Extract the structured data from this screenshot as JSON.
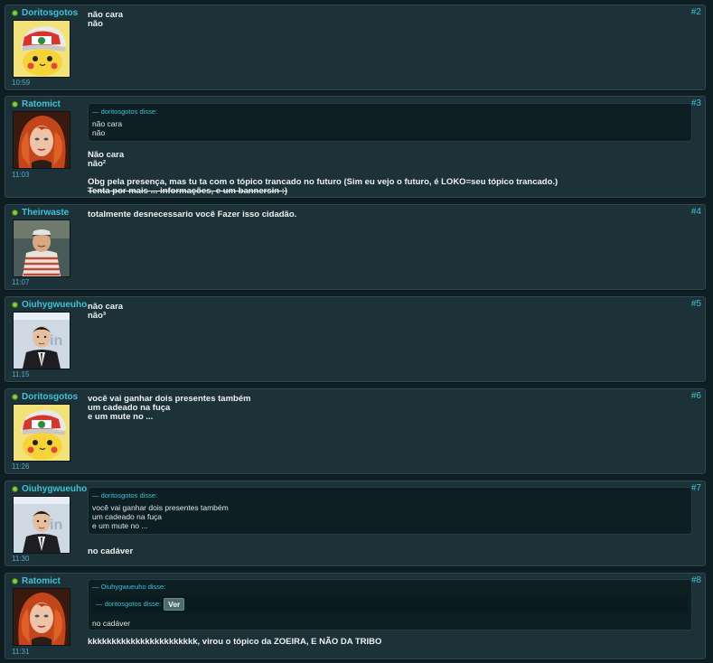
{
  "posts": [
    {
      "author": "Doritosgotos",
      "time": "10:59",
      "num": "#2",
      "avatar": "pikachu-ash-hat",
      "lines": [
        "não cara",
        "não"
      ]
    },
    {
      "author": "Ratomict",
      "time": "11:03",
      "num": "#3",
      "avatar": "redhead-woman",
      "quote": {
        "head": "— doritosgotos disse:",
        "lines": [
          "não cara",
          "não"
        ]
      },
      "lines": [
        "Não cara",
        "não²",
        "",
        "Obg pela presença, mas tu ta com o tópico trancado no futuro (Sim eu vejo o futuro, é LOKO=seu tópico trancado.)"
      ],
      "strike_line": "Tenta por mais ... informações, e um bannersin :)"
    },
    {
      "author": "Theirwaste",
      "time": "11:07",
      "num": "#4",
      "avatar": "man-striped-shirt",
      "lines": [
        "totalmente desnecessario você Fazer isso cidadão."
      ]
    },
    {
      "author": "Oiuhygwueuho",
      "time": "11:15",
      "num": "#5",
      "avatar": "man-in-suit",
      "lines": [
        "não cara",
        "não³"
      ]
    },
    {
      "author": "Doritosgotos",
      "time": "11:26",
      "num": "#6",
      "avatar": "pikachu-ash-hat",
      "lines": [
        "você vai ganhar dois presentes também",
        "um cadeado na fuça",
        "e um mute no ..."
      ]
    },
    {
      "author": "Oiuhygwueuho",
      "time": "11:30",
      "num": "#7",
      "avatar": "man-in-suit",
      "quote": {
        "head": "— doritosgotos disse:",
        "lines": [
          "você vai ganhar dois presentes também",
          "um cadeado na fuça",
          "e um mute no ..."
        ]
      },
      "lines": [
        "no cadáver"
      ]
    },
    {
      "author": "Ratomict",
      "time": "11:31",
      "num": "#8",
      "avatar": "redhead-woman",
      "quote": {
        "head": "— Oiuhygwueuho disse:",
        "inner_head": "— doritosgotos disse:",
        "button": "Ver",
        "lines": [
          "no cadáver"
        ]
      },
      "lines": [
        "kkkkkkkkkkkkkkkkkkkkkkk, virou o tópico da ZOEIRA, E NÃO DA TRIBO"
      ]
    }
  ],
  "colors": {
    "accent": "#3fc2d6",
    "online": "#7ecf3a",
    "panel": "#1c3238",
    "time": "#58a8c8"
  }
}
